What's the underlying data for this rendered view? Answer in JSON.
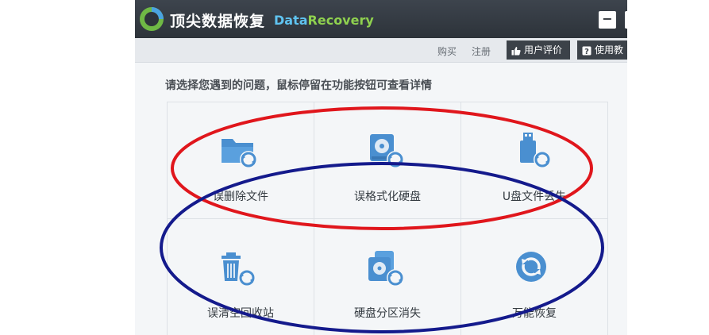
{
  "app": {
    "title": "顶尖数据恢复",
    "brand_part1": "Data",
    "brand_part2": "Recovery",
    "minimize_label": "−"
  },
  "toolbar": {
    "buy": "购买",
    "register": "注册",
    "review": "用户评价",
    "tutorial": "使用教"
  },
  "main": {
    "instruction": "请选择您遇到的问题，鼠标停留在功能按钮可查看详情",
    "tiles": [
      {
        "label": "误删除文件",
        "icon": "folder-recover-icon"
      },
      {
        "label": "误格式化硬盘",
        "icon": "hdd-recover-icon"
      },
      {
        "label": "U盘文件丢失",
        "icon": "usb-recover-icon"
      },
      {
        "label": "误清空回收站",
        "icon": "trash-recover-icon"
      },
      {
        "label": "硬盘分区消失",
        "icon": "partition-recover-icon"
      },
      {
        "label": "万能恢复",
        "icon": "universal-recover-icon"
      }
    ]
  },
  "colors": {
    "titlebar": "#2d333a",
    "accent_icon": "#4a8fd0",
    "annotation_red": "#e0161c",
    "annotation_blue": "#141a8c"
  }
}
